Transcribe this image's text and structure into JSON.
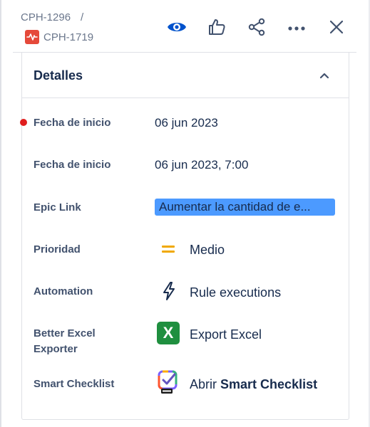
{
  "breadcrumb": {
    "parent_key": "CPH-1296",
    "separator": "/",
    "child_key": "CPH-1719"
  },
  "toolbar": {
    "icons": [
      "eye-icon",
      "thumbs-up-icon",
      "share-icon",
      "more-icon",
      "close-icon"
    ],
    "accent_color": "#0052cc"
  },
  "details": {
    "title": "Detalles",
    "fields": {
      "start_date": {
        "label": "Fecha de inicio",
        "value": "06 jun 2023"
      },
      "start_datetime": {
        "label": "Fecha de inicio",
        "value": "06 jun 2023, 7:00"
      },
      "epic_link": {
        "label": "Epic Link",
        "value": "Aumentar la cantidad de e..."
      },
      "priority": {
        "label": "Prioridad",
        "value": "Medio",
        "color": "#f0a800"
      },
      "automation": {
        "label": "Automation",
        "value": "Rule executions"
      },
      "excel": {
        "label_line1": "Better Excel",
        "label_line2": "Exporter",
        "value": "Export Excel",
        "icon_letter": "X",
        "color": "#1f8f3f"
      },
      "checklist": {
        "label": "Smart Checklist",
        "prefix": "Abrir",
        "value_bold": "Smart Checklist"
      }
    }
  }
}
